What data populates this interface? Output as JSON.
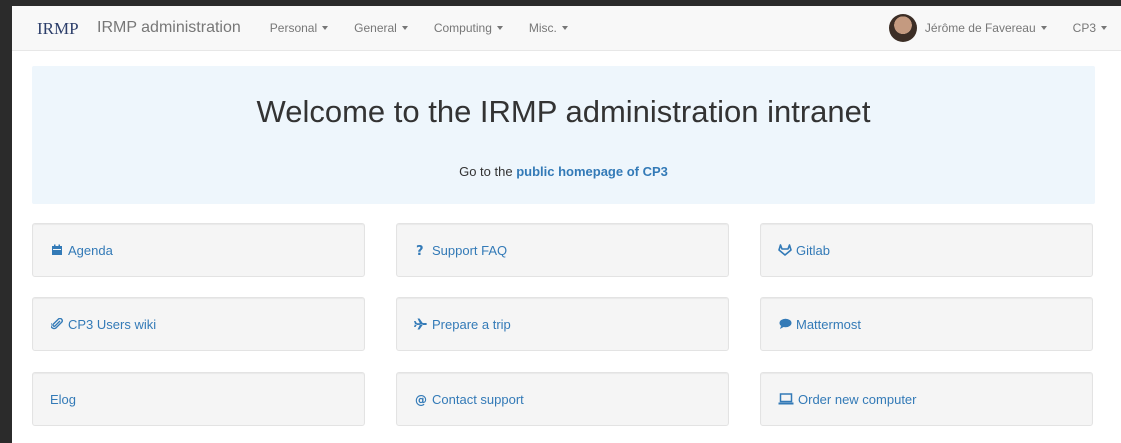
{
  "navbar": {
    "logo_text": "IRMP",
    "brand": "IRMP administration",
    "menus": [
      "Personal",
      "General",
      "Computing",
      "Misc."
    ],
    "user": "Jérôme de Favereau",
    "org": "CP3"
  },
  "jumbotron": {
    "title": "Welcome to the IRMP administration intranet",
    "sub_prefix": "Go to the",
    "sub_link": "public homepage of CP3"
  },
  "tiles": [
    {
      "label": "Agenda",
      "icon": "calendar-icon"
    },
    {
      "label": "Support FAQ",
      "icon": "question-icon"
    },
    {
      "label": "Gitlab",
      "icon": "gitlab-icon"
    },
    {
      "label": "CP3 Users wiki",
      "icon": "paperclip-icon"
    },
    {
      "label": "Prepare a trip",
      "icon": "plane-icon"
    },
    {
      "label": "Mattermost",
      "icon": "chat-icon"
    },
    {
      "label": "Elog",
      "icon": ""
    },
    {
      "label": "Contact support",
      "icon": "at-icon"
    },
    {
      "label": "Order new computer",
      "icon": "laptop-icon"
    }
  ],
  "colors": {
    "link": "#337ab7",
    "jumbotron_bg": "#eef6fc",
    "tile_bg": "#f5f5f5"
  }
}
